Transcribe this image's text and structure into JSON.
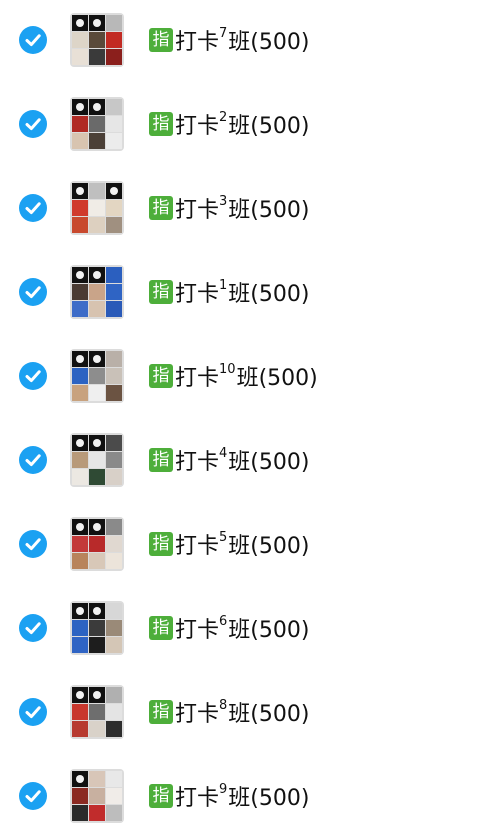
{
  "colors": {
    "check": "#1ba1f2",
    "badge": "#4dae3a",
    "text": "#111111"
  },
  "icons": {
    "check": "check-circle-icon",
    "badge": "zhi-badge-icon"
  },
  "groups": [
    {
      "badge": "指",
      "prefix": "打卡",
      "num": "7",
      "suffix": "班(500)",
      "checked": true,
      "tiles": [
        "logo",
        "logo",
        "#b8b8b8",
        "#ddd5c8",
        "#5a4a3a",
        "#c22b23",
        "#e8e0d6",
        "#3a3a3a",
        "#8b1f1c"
      ]
    },
    {
      "badge": "指",
      "prefix": "打卡",
      "num": "2",
      "suffix": "班(500)",
      "checked": true,
      "tiles": [
        "logo",
        "logo",
        "#c7c7c7",
        "#b02a24",
        "#6a6a6a",
        "#e6e6e6",
        "#d8c4b0",
        "#4b4037",
        "#ececec"
      ]
    },
    {
      "badge": "指",
      "prefix": "打卡",
      "num": "3",
      "suffix": "班(500)",
      "checked": true,
      "tiles": [
        "logo",
        "#bfbfbf",
        "logo",
        "#d03a2c",
        "#f0ece6",
        "#e3d6c2",
        "#c8492e",
        "#ddd0c0",
        "#a09080"
      ]
    },
    {
      "badge": "指",
      "prefix": "打卡",
      "num": "1",
      "suffix": "班(500)",
      "checked": true,
      "tiles": [
        "logo",
        "logo",
        "#2b5fbf",
        "#4a3b33",
        "#c9a489",
        "#2f64c4",
        "#3d6cc8",
        "#d7c3b0",
        "#2a5ab8"
      ]
    },
    {
      "badge": "指",
      "prefix": "打卡",
      "num": "10",
      "suffix": "班(500)",
      "checked": true,
      "tiles": [
        "logo",
        "logo",
        "#b9b0a8",
        "#2c63c2",
        "#8d8d8d",
        "#c9c1b8",
        "#c8a27e",
        "#efefef",
        "#6b5342"
      ]
    },
    {
      "badge": "指",
      "prefix": "打卡",
      "num": "4",
      "suffix": "班(500)",
      "checked": true,
      "tiles": [
        "logo",
        "logo",
        "#4b4b4b",
        "#b89a7a",
        "#e6e6e6",
        "#8a8a8a",
        "#ece8e2",
        "#2f4a34",
        "#d8d0c8"
      ]
    },
    {
      "badge": "指",
      "prefix": "打卡",
      "num": "5",
      "suffix": "班(500)",
      "checked": true,
      "tiles": [
        "logo",
        "logo",
        "#8a8a8a",
        "#c33a3a",
        "#b82a2a",
        "#e0d8d0",
        "#b8845c",
        "#d8c8b8",
        "#ece4da"
      ]
    },
    {
      "badge": "指",
      "prefix": "打卡",
      "num": "6",
      "suffix": "班(500)",
      "checked": true,
      "tiles": [
        "logo",
        "logo",
        "#d7d7d7",
        "#2c63c2",
        "#3b3b3b",
        "#9a8a78",
        "#2f64c4",
        "#1d1d1d",
        "#d4c6b6"
      ]
    },
    {
      "badge": "指",
      "prefix": "打卡",
      "num": "8",
      "suffix": "班(500)",
      "checked": true,
      "tiles": [
        "logo",
        "logo",
        "#b0b0b0",
        "#c8372d",
        "#6e6e6e",
        "#e4e4e4",
        "#b73a30",
        "#d9d2c9",
        "#2d2d2d"
      ]
    },
    {
      "badge": "指",
      "prefix": "打卡",
      "num": "9",
      "suffix": "班(500)",
      "checked": true,
      "tiles": [
        "logo",
        "#d8c6b8",
        "#e8e8e8",
        "#8b2a22",
        "#c8b0a0",
        "#f0ece8",
        "#2a2a2a",
        "#c12c2c",
        "#bdbdbd"
      ]
    }
  ]
}
